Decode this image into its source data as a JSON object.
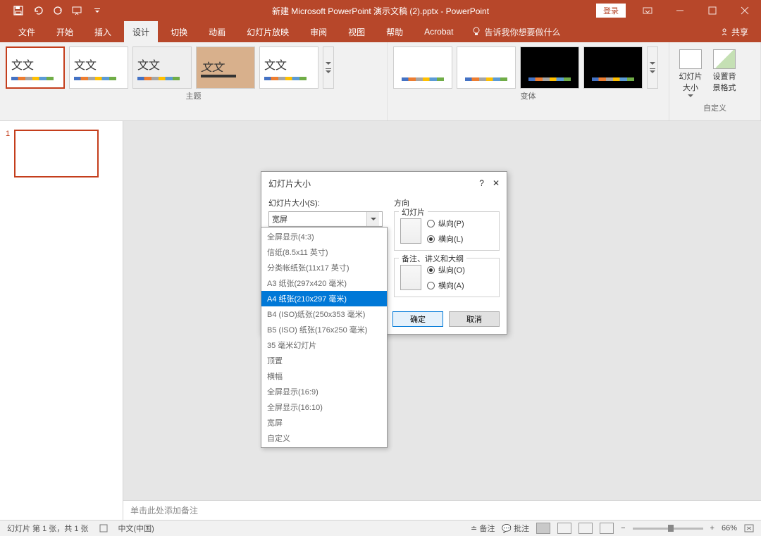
{
  "titlebar": {
    "title": "新建 Microsoft PowerPoint 演示文稿 (2).pptx - PowerPoint",
    "login": "登录"
  },
  "tabs": {
    "file": "文件",
    "home": "开始",
    "insert": "插入",
    "design": "设计",
    "transitions": "切换",
    "animations": "动画",
    "slideshow": "幻灯片放映",
    "review": "审阅",
    "view": "视图",
    "help": "帮助",
    "acrobat": "Acrobat",
    "tellme": "告诉我你想要做什么",
    "share": "共享"
  },
  "ribbon": {
    "themes_label": "主题",
    "variants_label": "变体",
    "customize_label": "自定义",
    "theme_text": "文文",
    "slide_size": "幻灯片大小",
    "bg_format": "设置背景格式"
  },
  "slide_panel": {
    "num": "1"
  },
  "notes": {
    "placeholder": "单击此处添加备注"
  },
  "statusbar": {
    "slide_info": "幻灯片 第 1 张，共 1 张",
    "lang": "中文(中国)",
    "notes": "备注",
    "comments": "批注",
    "zoom": "66%"
  },
  "dialog": {
    "title": "幻灯片大小",
    "size_label": "幻灯片大小(S):",
    "size_value": "宽屏",
    "orientation_label": "方向",
    "slides_label": "幻灯片",
    "portrait": "纵向(P)",
    "landscape": "横向(L)",
    "notes_label": "备注、讲义和大纲",
    "portrait2": "纵向(O)",
    "landscape2": "横向(A)",
    "ok": "确定",
    "cancel": "取消"
  },
  "dropdown": {
    "items": [
      "全屏显示(4:3)",
      "信纸(8.5x11 英寸)",
      "分类帐纸张(11x17 英寸)",
      "A3 纸张(297x420 毫米)",
      "A4 纸张(210x297 毫米)",
      "B4 (ISO)纸张(250x353 毫米)",
      "B5 (ISO) 纸张(176x250 毫米)",
      "35 毫米幻灯片",
      "顶置",
      "横幅",
      "全屏显示(16:9)",
      "全屏显示(16:10)",
      "宽屏",
      "自定义"
    ],
    "selected_index": 4
  }
}
